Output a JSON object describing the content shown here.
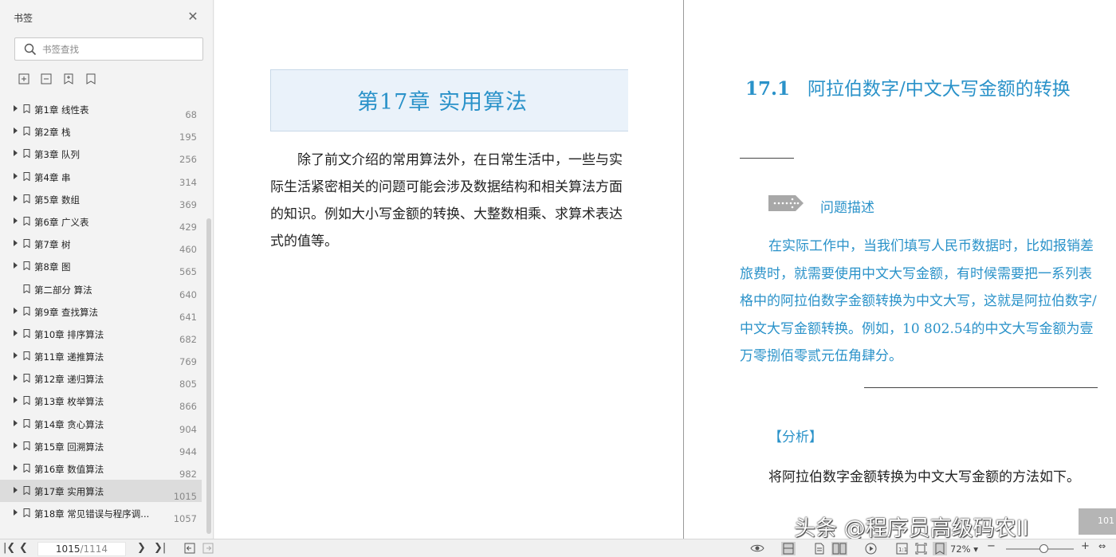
{
  "sidebar": {
    "title": "书签",
    "search_placeholder": "书签查找",
    "items": [
      {
        "label": "第1章 线性表",
        "page": "68",
        "expandable": true
      },
      {
        "label": "第2章 栈",
        "page": "195",
        "expandable": true
      },
      {
        "label": "第3章 队列",
        "page": "256",
        "expandable": true
      },
      {
        "label": "第4章 串",
        "page": "314",
        "expandable": true
      },
      {
        "label": "第5章 数组",
        "page": "369",
        "expandable": true
      },
      {
        "label": "第6章 广义表",
        "page": "429",
        "expandable": true
      },
      {
        "label": "第7章 树",
        "page": "460",
        "expandable": true
      },
      {
        "label": "第8章 图",
        "page": "565",
        "expandable": true
      },
      {
        "label": "第二部分 算法",
        "page": "640",
        "expandable": false
      },
      {
        "label": "第9章 查找算法",
        "page": "641",
        "expandable": true
      },
      {
        "label": "第10章 排序算法",
        "page": "682",
        "expandable": true
      },
      {
        "label": "第11章 递推算法",
        "page": "769",
        "expandable": true
      },
      {
        "label": "第12章 递归算法",
        "page": "805",
        "expandable": true
      },
      {
        "label": "第13章 枚举算法",
        "page": "866",
        "expandable": true
      },
      {
        "label": "第14章 贪心算法",
        "page": "904",
        "expandable": true
      },
      {
        "label": "第15章 回溯算法",
        "page": "944",
        "expandable": true
      },
      {
        "label": "第16章 数值算法",
        "page": "982",
        "expandable": true
      },
      {
        "label": "第17章 实用算法",
        "page": "1015",
        "expandable": true,
        "active": true
      },
      {
        "label": "第18章 常见错误与程序调...",
        "page": "1057",
        "expandable": true
      }
    ]
  },
  "left_page": {
    "chapter_title": "第17章    实用算法",
    "paragraph": "除了前文介绍的常用算法外，在日常生活中，一些与实际生活紧密相关的问题可能会涉及数据结构和相关算法方面的知识。例如大小写金额的转换、大整数相乘、求算术表达式的值等。"
  },
  "right_page": {
    "section_number": "17.1",
    "section_title": "阿拉伯数字/中文大写金额的转换",
    "problem_label": "问题描述",
    "problem_text": "在实际工作中，当我们填写人民币数据时，比如报销差旅费时，就需要使用中文大写金额，有时候需要把一系列表格中的阿拉伯数字金额转换为中文大写，这就是阿拉伯数字/中文大写金额转换。例如，10 802.54的中文大写金额为壹万零捌佰零贰元伍角肆分。",
    "analysis_label": "【分析】",
    "analysis_text": "将阿拉伯数字金额转换为中文大写金额的方法如下。",
    "page_badge": "101"
  },
  "watermark": "头条 @程序员高级码农II",
  "bottombar": {
    "current_page": "1015",
    "total_pages": "/1114",
    "zoom": "72%"
  },
  "colors": {
    "accent": "#2a92c9",
    "sidebar_bg": "#f3f3f3",
    "active_row": "#dcdcdc"
  }
}
